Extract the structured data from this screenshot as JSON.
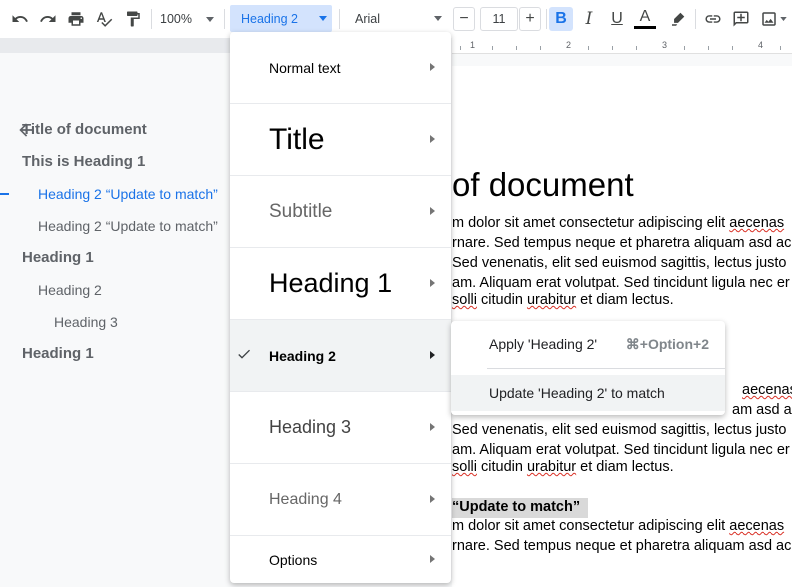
{
  "toolbar": {
    "icons": [
      "undo-icon",
      "redo-icon",
      "print-icon",
      "spellcheck-icon",
      "paint-format-icon",
      "bold-icon",
      "italic-icon",
      "underline-icon",
      "text-color-icon",
      "highlight-icon",
      "link-icon",
      "comment-icon",
      "image-icon"
    ],
    "zoom": "100%",
    "paragraph_style": "Heading 2",
    "font": "Arial",
    "font_size": "11",
    "minus": "−",
    "plus": "+",
    "bold": "B",
    "italic": "I",
    "underline": "U",
    "text_color_letter": "A",
    "accent": "#1a73e8",
    "bold_active_bg": "#d3e3fd"
  },
  "ruler": {
    "numbers": [
      "1",
      "2",
      "3",
      "4"
    ]
  },
  "outline": {
    "items": [
      {
        "label": "Title of document",
        "level": "title"
      },
      {
        "label": "This is Heading 1",
        "level": "h1"
      },
      {
        "label": "Heading 2 “Update to match”",
        "level": "h2",
        "active": true
      },
      {
        "label": "Heading 2 “Update to match”",
        "level": "h2"
      },
      {
        "label": "Heading 1",
        "level": "h1"
      },
      {
        "label": "Heading 2",
        "level": "h2"
      },
      {
        "label": "Heading 3",
        "level": "h3"
      },
      {
        "label": "Heading 1",
        "level": "h1"
      }
    ]
  },
  "document": {
    "title_fragment": "of document",
    "para1": [
      "m dolor sit amet consectetur adipiscing elit ",
      "aecenas",
      "rnare. Sed tempus neque et pharetra aliquam asd ac",
      " Sed venenatis, elit sed euismod sagittis, lectus justo",
      "am. Aliquam erat volutpat. Sed tincidunt ligula nec er",
      "solli",
      " citudin ",
      "urabitur",
      " et diam lectus."
    ],
    "para2": [
      "aecenas",
      "am asd ac",
      " Sed venenatis, elit sed euismod sagittis, lectus justo",
      "am. Aliquam erat volutpat. Sed tincidunt ligula nec er",
      "solli",
      " citudin ",
      "urabitur",
      " et diam lectus."
    ],
    "heading_fragment": "“Update to match”",
    "para3": [
      "m dolor sit amet consectetur adipiscing elit ",
      "aecenas",
      "rnare. Sed tempus neque et pharetra aliquam asd ac"
    ]
  },
  "style_menu": {
    "items": [
      {
        "label": "Normal text",
        "name": "normal-text"
      },
      {
        "label": "Title",
        "name": "title"
      },
      {
        "label": "Subtitle",
        "name": "subtitle"
      },
      {
        "label": "Heading 1",
        "name": "heading-1"
      },
      {
        "label": "Heading 2",
        "name": "heading-2",
        "selected": true
      },
      {
        "label": "Heading 3",
        "name": "heading-3"
      },
      {
        "label": "Heading 4",
        "name": "heading-4"
      },
      {
        "label": "Options",
        "name": "options"
      }
    ]
  },
  "submenu": {
    "apply_label": "Apply 'Heading 2'",
    "apply_shortcut": "⌘+Option+2",
    "update_label": "Update 'Heading 2' to match"
  }
}
